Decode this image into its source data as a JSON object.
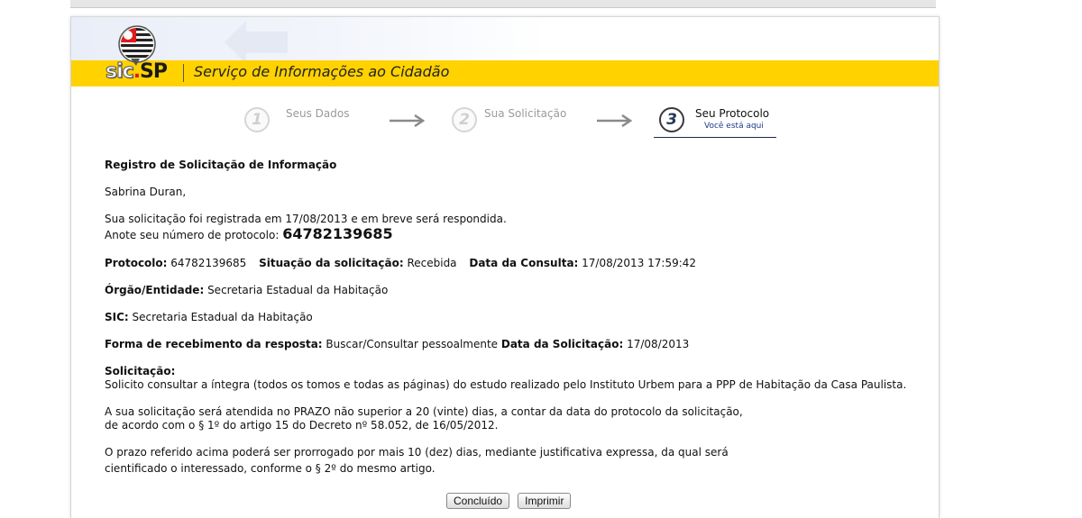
{
  "header": {
    "logo_text_sic": "sic",
    "logo_text_dot": ".",
    "logo_text_sp": "SP",
    "site_title": "Serviço de Informações ao Cidadão"
  },
  "steps": [
    {
      "number": "1",
      "label": "Seus Dados",
      "active": false
    },
    {
      "number": "2",
      "label": "Sua Solicitação",
      "active": false
    },
    {
      "number": "3",
      "label": "Seu Protocolo",
      "active": true,
      "sublabel": "Você está aqui"
    }
  ],
  "registro": {
    "heading": "Registro de Solicitação de Informação",
    "greeting": "Sabrina Duran,",
    "line1": "Sua solicitação foi registrada em 17/08/2013 e em breve será respondida.",
    "anote_label": "Anote seu número de protocolo: ",
    "protocol_number": "64782139685"
  },
  "details": {
    "protocolo_label": "Protocolo:",
    "protocolo_value": " 64782139685",
    "situacao_label": "Situação da solicitação:",
    "situacao_value": " Recebida",
    "data_consulta_label": "Data da Consulta:",
    "data_consulta_value": " 17/08/2013 17:59:42",
    "orgao_label": "Órgão/Entidade:",
    "orgao_value": " Secretaria Estadual da Habitação",
    "sic_label": "SIC:",
    "sic_value": " Secretaria Estadual da Habitação",
    "forma_label": "Forma de recebimento da resposta:",
    "forma_value": " Buscar/Consultar pessoalmente ",
    "data_solicitacao_label": "Data da Solicitação:",
    "data_solicitacao_value": " 17/08/2013",
    "solicitacao_label": "Solicitação:",
    "solicitacao_text": "Solicito consultar a íntegra (todos os tomos e todas as páginas) do estudo realizado pelo Instituto Urbem para a PPP de Habitação da Casa Paulista."
  },
  "notes": {
    "prazo_line1": "A sua solicitação será atendida no PRAZO não superior a 20 (vinte) dias, a contar da data do protocolo da solicitação,",
    "prazo_line2": "de acordo com o § 1º do artigo 15 do Decreto nº 58.052, de 16/05/2012.",
    "prorrogado_line1": "O prazo referido acima poderá ser prorrogado por mais 10 (dez) dias, mediante justificativa expressa, da qual será",
    "prorrogado_line2": "cientificado o interessado, conforme o § 2º do mesmo artigo."
  },
  "buttons": {
    "concluido": "Concluído",
    "imprimir": "Imprimir"
  },
  "colors": {
    "header_yellow": "#ffd200",
    "logo_red": "#e01b1b",
    "step_link_blue": "#1a3a8a"
  },
  "icons": [
    "sp-flag-emblem-icon",
    "arrow-right-icon"
  ]
}
